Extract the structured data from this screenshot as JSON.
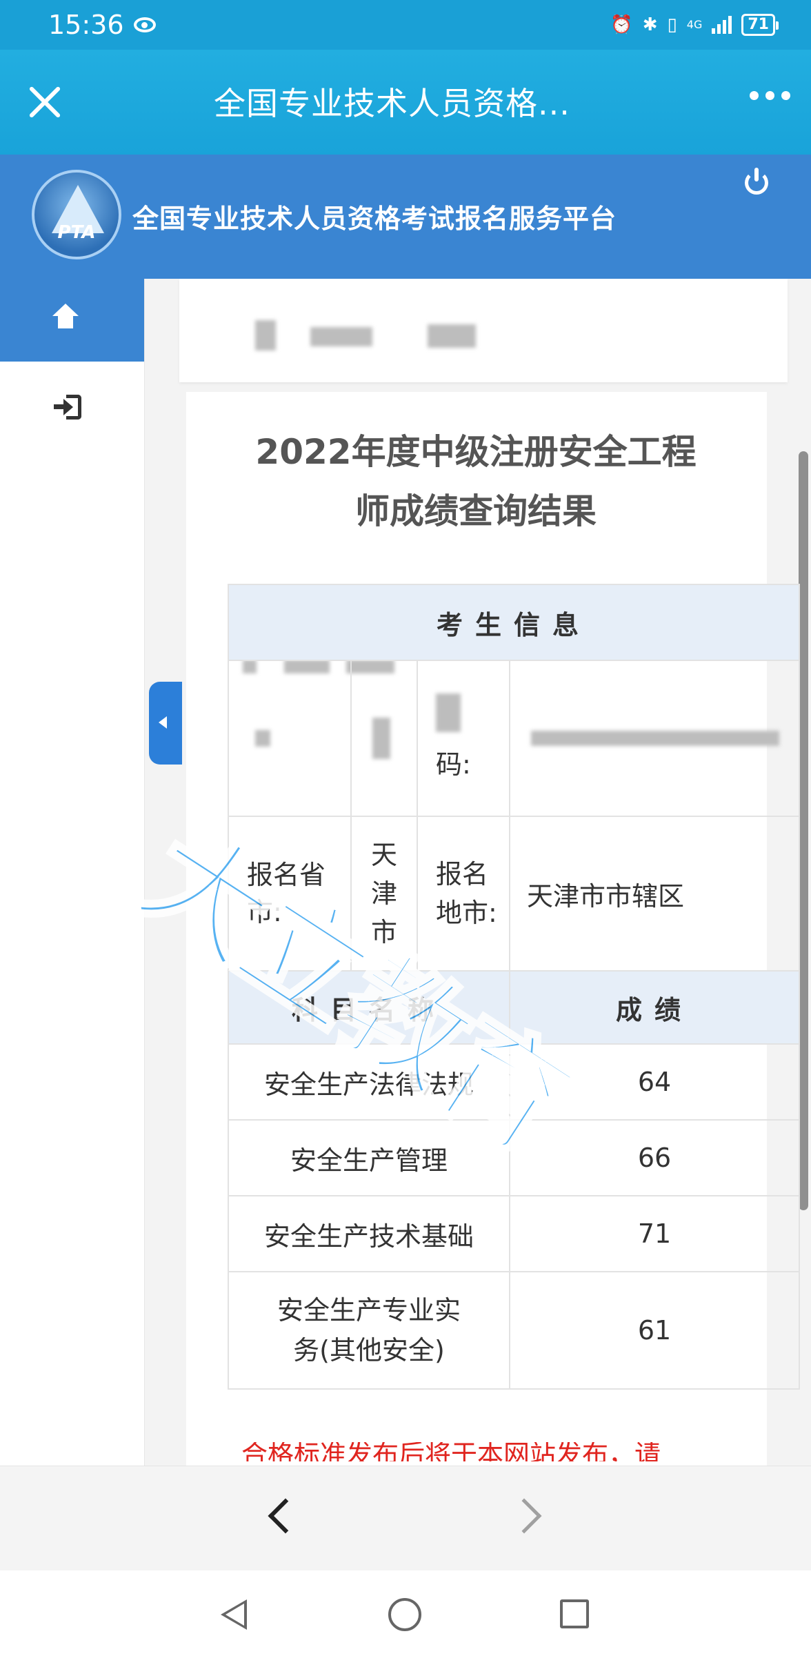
{
  "status_bar": {
    "time": "15:36",
    "network": "4G",
    "battery": "71"
  },
  "title_bar": {
    "title": "全国专业技术人员资格..."
  },
  "site_header": {
    "logo_text": "PTA",
    "site_title": "全国专业技术人员资格考试报名服务平台"
  },
  "result": {
    "title_line1": "2022年度中级注册安全工程",
    "title_line2": "师成绩查询结果",
    "info_header": "考生信息",
    "partial_label": "码:",
    "province_label": "报名省市:",
    "province_value": "天津市",
    "city_label": "报名地市:",
    "city_value": "天津市市辖区",
    "subject_header": "科目名称",
    "score_header": "成绩",
    "subjects": [
      {
        "name": "安全生产法律法规",
        "score": "64"
      },
      {
        "name": "安全生产管理",
        "score": "66"
      },
      {
        "name": "安全生产技术基础",
        "score": "71"
      },
      {
        "name": "安全生产专业实务(其他安全)",
        "score": "61"
      }
    ],
    "notice": "合格标准发布后将于本网站发布，请"
  },
  "watermark": "大立教育",
  "colors": {
    "status_bar": "#1aa0d6",
    "header": "#3a85d2",
    "table_header": "#e6eef8",
    "notice": "#e0251f",
    "watermark": "#3aa5f0"
  }
}
